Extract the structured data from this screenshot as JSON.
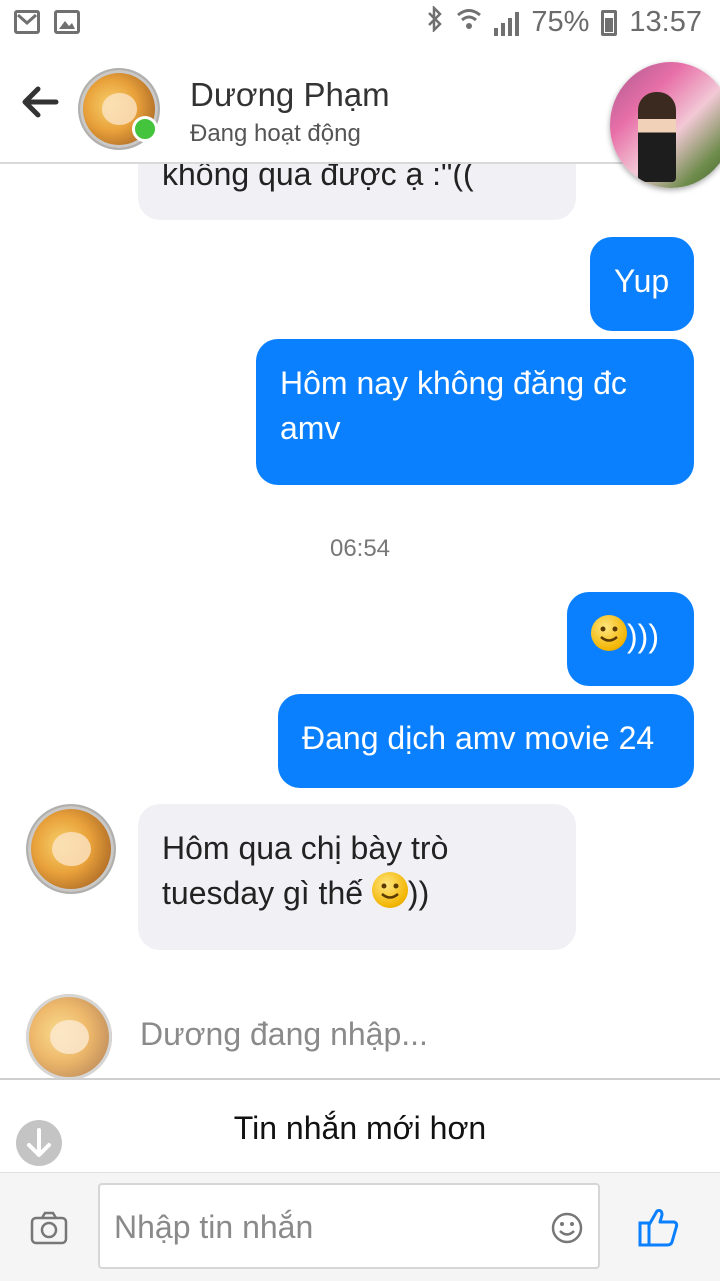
{
  "status_bar": {
    "battery_percent": "75%",
    "time": "13:57",
    "left_icons": [
      "gmail-icon",
      "gallery-icon"
    ],
    "right_icons": [
      "bluetooth-icon",
      "wifi-icon",
      "signal-icon",
      "battery-icon"
    ]
  },
  "header": {
    "contact_name": "Dương Phạm",
    "contact_status": "Đang hoạt động",
    "online": true
  },
  "messages": [
    {
      "direction": "incoming",
      "text": "không qua được ạ :\"((",
      "partial": true
    },
    {
      "direction": "outgoing",
      "text": "Yup"
    },
    {
      "direction": "outgoing",
      "line1": "Hôm nay không đăng đc",
      "line2": "amv"
    },
    {
      "direction": "outgoing",
      "text": ")))",
      "emoji": "slightly-smiling-face"
    },
    {
      "direction": "outgoing",
      "text": "Đang dịch amv movie 24"
    },
    {
      "direction": "incoming",
      "line1": "Hôm qua chị bày trò",
      "line2": "tuesday gì thế",
      "line2_suffix": "))",
      "emoji": "slightly-smiling-face"
    }
  ],
  "timestamp": "06:54",
  "typing_indicator": "Dương đang nhập...",
  "newer_messages_label": "Tin nhắn mới hơn",
  "composer": {
    "placeholder": "Nhập tin nhắn"
  },
  "colors": {
    "outgoing_bubble": "#0a80ff",
    "incoming_bubble": "#f0f0f5",
    "online_dot": "#44c33c",
    "like_icon": "#0a80ff"
  }
}
